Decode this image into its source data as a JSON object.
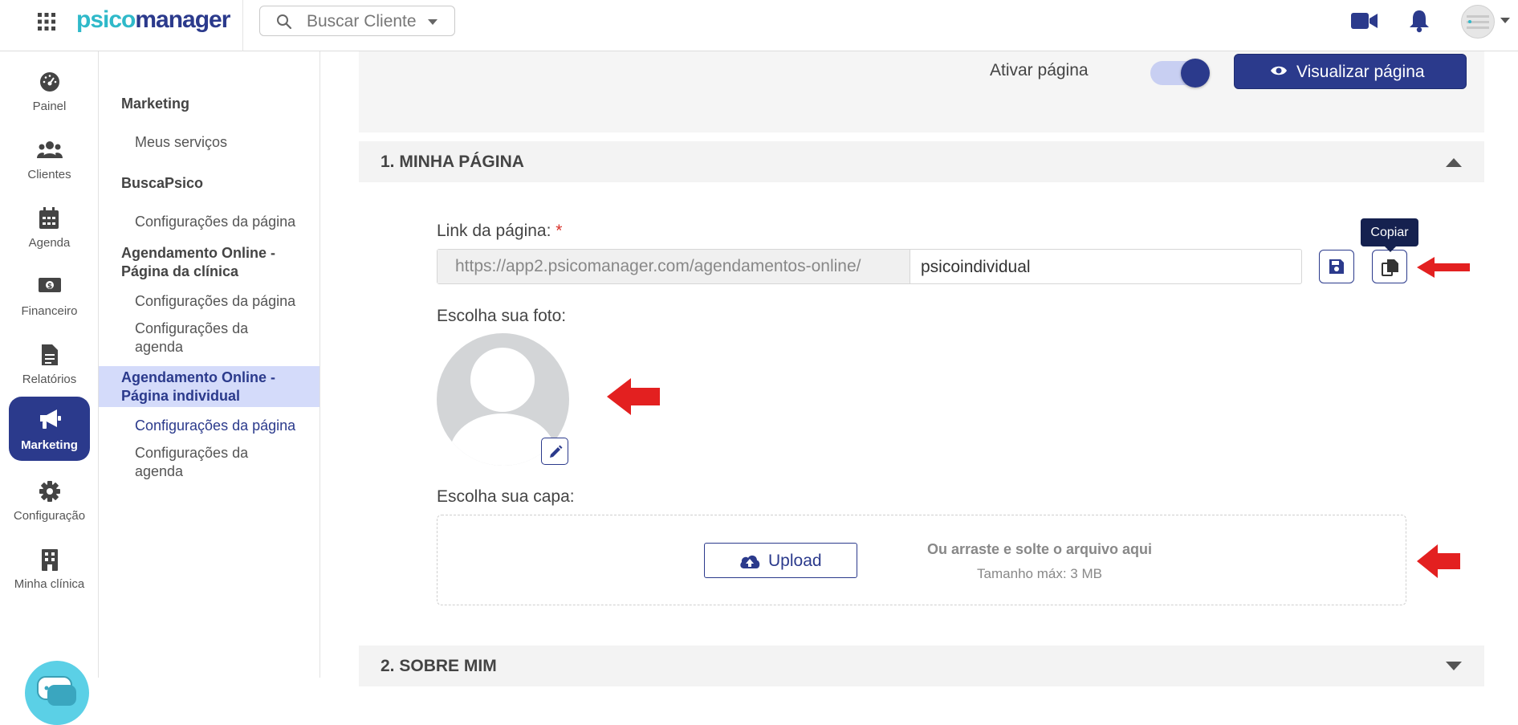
{
  "brand": {
    "logo_part1": "psico",
    "logo_part2": "manager"
  },
  "search": {
    "placeholder": "Buscar Cliente"
  },
  "rail": [
    {
      "label": "Painel",
      "icon": "gauge-icon"
    },
    {
      "label": "Clientes",
      "icon": "users-icon"
    },
    {
      "label": "Agenda",
      "icon": "calendar-icon"
    },
    {
      "label": "Financeiro",
      "icon": "money-icon"
    },
    {
      "label": "Relatórios",
      "icon": "report-icon"
    },
    {
      "label": "Marketing",
      "icon": "megaphone-icon",
      "active": true
    },
    {
      "label": "Configuração",
      "icon": "gear-icon"
    },
    {
      "label": "Minha clínica",
      "icon": "building-icon"
    }
  ],
  "subnav": {
    "marketing": "Marketing",
    "meus_servicos": "Meus serviços",
    "buscapsico": "BuscaPsico",
    "buscapsico_config": "Configurações da página",
    "clinica_head": "Agendamento Online - Página da clínica",
    "clinica_config_pagina": "Configurações da página",
    "clinica_config_agenda": "Configurações da agenda",
    "individual_head": "Agendamento Online - Página individual",
    "individual_config_pagina": "Configurações da página",
    "individual_config_agenda": "Configurações da agenda"
  },
  "header": {
    "toggle_label": "Ativar página",
    "toggle_on": true,
    "view_button": "Visualizar página"
  },
  "section1": {
    "title": "1. MINHA PÁGINA",
    "link_label": "Link da página:",
    "required_mark": "*",
    "link_prefix": "https://app2.psicomanager.com/agendamentos-online/",
    "link_value": "psicoindividual",
    "copy_tooltip": "Copiar",
    "photo_label": "Escolha sua foto:",
    "cover_label": "Escolha sua capa:",
    "upload_button": "Upload",
    "drop_text": "Ou arraste e solte o arquivo aqui",
    "max_size": "Tamanho máx: 3 MB"
  },
  "section2": {
    "title": "2. SOBRE MIM"
  },
  "colors": {
    "primary": "#2b3a8c",
    "accent": "#2fb9c9",
    "active_bg": "#d4dbfa",
    "arrow": "#e32020"
  }
}
